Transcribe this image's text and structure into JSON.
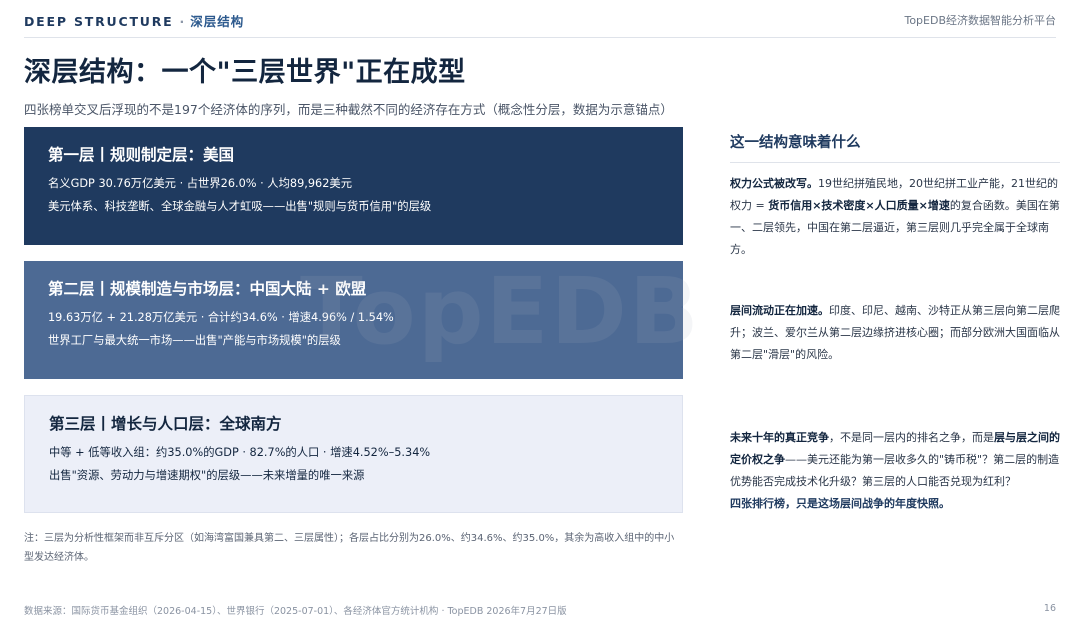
{
  "header": {
    "section_en": "DEEP STRUCTURE",
    "separator": "·",
    "section_zh": "深层结构",
    "platform": "TopEDB经济数据智能分析平台"
  },
  "title": "深层结构：一个\"三层世界\"正在成型",
  "subtitle": "四张榜单交叉后浮现的不是197个经济体的序列，而是三种截然不同的经济存在方式（概念性分层，数据为示意锚点）",
  "watermark": "TopEDB",
  "layers": [
    {
      "title": "第一层丨规则制定层：美国",
      "line1": "名义GDP 30.76万亿美元 · 占世界26.0% · 人均89,962美元",
      "line2": "美元体系、科技垄断、全球金融与人才虹吸——出售\"规则与货币信用\"的层级"
    },
    {
      "title": "第二层丨规模制造与市场层：中国大陆 + 欧盟",
      "line1": "19.63万亿 + 21.28万亿美元 · 合计约34.6% · 增速4.96% / 1.54%",
      "line2": "世界工厂与最大统一市场——出售\"产能与市场规模\"的层级"
    },
    {
      "title": "第三层丨增长与人口层：全球南方",
      "line1": "中等 + 低等收入组：约35.0%的GDP · 82.7%的人口 · 增速4.52%–5.34%",
      "line2": "出售\"资源、劳动力与增速期权\"的层级——未来增量的唯一来源"
    }
  ],
  "note": "注：三层为分析性框架而非互斥分区（如海湾富国兼具第二、三层属性）；各层占比分别为26.0%、约34.6%、约35.0%，其余为高收入组中的中小型发达经济体。",
  "side": {
    "heading": "这一结构意味着什么",
    "p1_lead": "权力公式被改写。",
    "p1_a": "19世纪拼殖民地，20世纪拼工业产能，21世纪的权力 = ",
    "p1_bold": "货币信用×技术密度×人口质量×增速",
    "p1_b": "的复合函数。美国在第一、二层领先，中国在第二层逼近，第三层则几乎完全属于全球南方。",
    "p2_lead": "层间流动正在加速。",
    "p2_a": "印度、印尼、越南、沙特正从第三层向第二层爬升；波兰、爱尔兰从第二层边缘挤进核心圈；而部分欧洲大国面临从第二层\"滑层\"的风险。",
    "p3_lead": "未来十年的真正竞争",
    "p3_a": "，不是同一层内的排名之争，而是",
    "p3_bold": "层与层之间的定价权之争",
    "p3_b": "——美元还能为第一层收多久的\"铸币税\"？第二层的制造优势能否完成技术化升级？第三层的人口能否兑现为红利？",
    "p3_end": "四张排行榜，只是这场层间战争的年度快照。"
  },
  "footer": {
    "source": "数据来源：国际货币基金组织（2026-04-15）、世界银行（2025-07-01）、各经济体官方统计机构 · TopEDB 2026年7月27日版",
    "page": "16"
  }
}
